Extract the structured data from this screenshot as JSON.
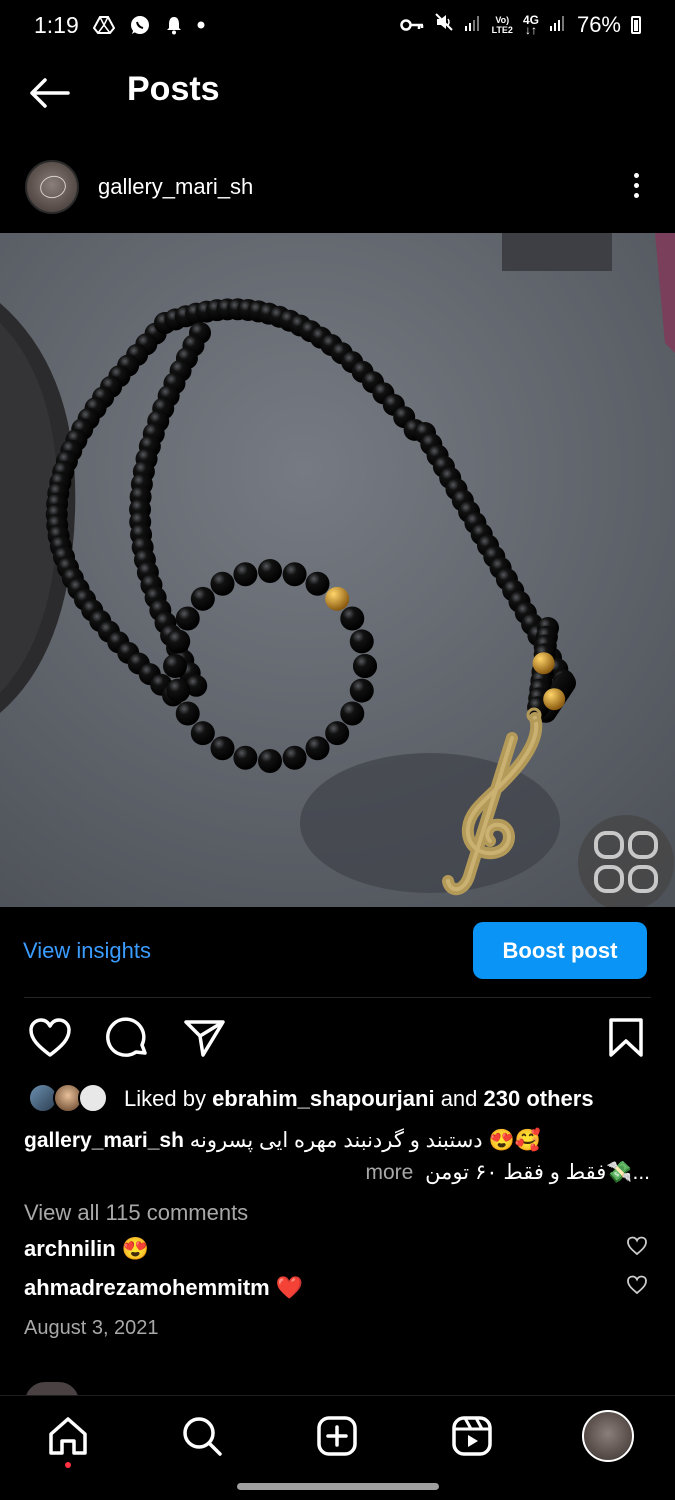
{
  "status_bar": {
    "time": "1:19",
    "network_top": "Vo)",
    "network_bottom": "LTE2",
    "signal_type": "4G",
    "battery": "76%",
    "icons": [
      "drive-icon",
      "whatsapp-icon",
      "notification-bell-icon",
      "dot-icon",
      "key-icon",
      "mute-icon",
      "signal-icon",
      "signal-icon-2"
    ]
  },
  "header": {
    "title": "Posts",
    "back_icon": "back-arrow-icon"
  },
  "post": {
    "username": "gallery_mari_sh",
    "more_icon": "more-vertical-icon",
    "image_alt": "Black bead necklace with gold treble clef pendant and matching bracelet",
    "carousel_icon": "carousel-grid-icon"
  },
  "insights": {
    "view_label": "View insights",
    "boost_label": "Boost post"
  },
  "actions": {
    "like_icon": "heart-icon",
    "comment_icon": "comment-icon",
    "share_icon": "share-icon",
    "save_icon": "bookmark-icon"
  },
  "likes": {
    "prefix": "Liked by ",
    "user": "ebrahim_shapourjani",
    "middle": " and ",
    "others": "230 others"
  },
  "caption": {
    "username": "gallery_mari_sh",
    "text_line1": "دستبند و گردنبند مهره ایی پسرونه 😍🥰",
    "text_line2": "فقط و فقط ۶۰ تومن💸...",
    "more_label": "more"
  },
  "comments": {
    "view_all": "View all 115 comments",
    "items": [
      {
        "username": "archnilin",
        "emoji": "😍"
      },
      {
        "username": "ahmadrezamohemmitm",
        "emoji": "❤️"
      }
    ]
  },
  "date": "August 3, 2021",
  "bottom_nav": {
    "items": [
      "home-icon",
      "search-icon",
      "create-post-icon",
      "reels-icon",
      "profile-avatar"
    ]
  },
  "colors": {
    "accent_blue": "#0a95f6",
    "link_blue": "#3b9cff",
    "muted_text": "#a8a8a8",
    "notification_red": "#ff3040"
  }
}
